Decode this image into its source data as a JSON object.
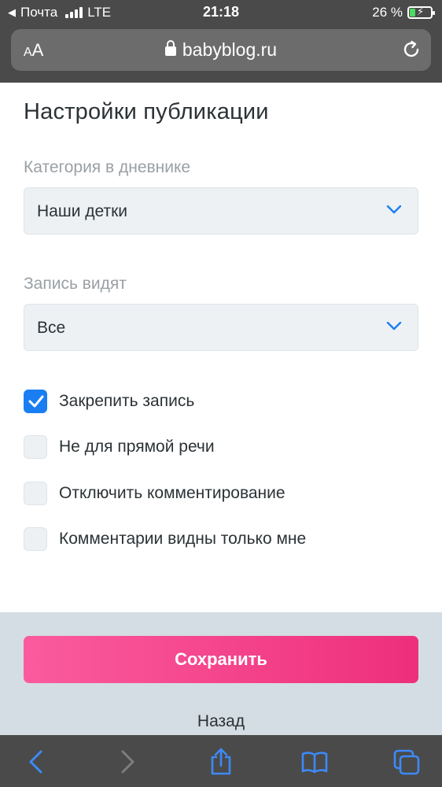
{
  "status_bar": {
    "carrier": "Почта",
    "network": "LTE",
    "time": "21:18",
    "battery": "26 %",
    "battery_level": 0.26
  },
  "browser": {
    "text_size_label_small": "A",
    "text_size_label_large": "A",
    "url": "babyblog.ru"
  },
  "form": {
    "title": "Настройки публикации",
    "category": {
      "label": "Категория в дневнике",
      "value": "Наши детки"
    },
    "visibility": {
      "label": "Запись видят",
      "value": "Все"
    },
    "checkboxes": [
      {
        "label": "Закрепить запись",
        "checked": true
      },
      {
        "label": "Не для прямой речи",
        "checked": false
      },
      {
        "label": "Отключить комментирование",
        "checked": false
      },
      {
        "label": "Комментарии видны только мне",
        "checked": false
      }
    ]
  },
  "actions": {
    "save_label": "Сохранить",
    "back_label": "Назад"
  },
  "colors": {
    "accent_blue": "#1a7ef2",
    "save_gradient_start": "#fb5b9e",
    "save_gradient_end": "#ee2f7b",
    "footer_bg": "#d4dde3",
    "toolbar_icon": "#3d8af7"
  },
  "toolbar": {
    "icons": [
      "back-icon",
      "forward-icon",
      "share-icon",
      "bookmarks-icon",
      "tabs-icon"
    ]
  }
}
